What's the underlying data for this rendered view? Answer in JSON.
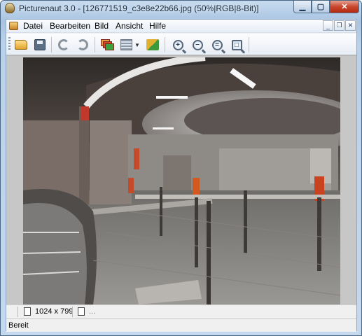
{
  "window": {
    "title": "Picturenaut 3.0 - [126771519_c3e8e22b66.jpg (50%|RGB|8-Bit)]"
  },
  "menubar": {
    "items": [
      "Datei",
      "Bearbeiten",
      "Bild",
      "Ansicht",
      "Hilfe"
    ]
  },
  "toolbar": {
    "icons": [
      "open-folder-icon",
      "save-icon",
      "undo-icon",
      "redo-icon",
      "layers-icon",
      "list-icon",
      "dropdown-arrow-icon",
      "plugin-icon",
      "zoom-in-icon",
      "zoom-out-icon",
      "zoom-fit-icon",
      "zoom-actual-icon"
    ]
  },
  "status": {
    "dimensions": "1024 x 799",
    "extra": "...",
    "ready": "Bereit"
  },
  "colors": {
    "title_bar": "#b9d1ea",
    "close_button": "#c8472d",
    "viewport_bg": "#c7c7c7"
  }
}
